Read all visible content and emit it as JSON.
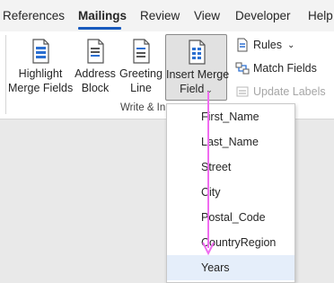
{
  "tabs": [
    {
      "label": "References",
      "active": false
    },
    {
      "label": "Mailings",
      "active": true
    },
    {
      "label": "Review",
      "active": false
    },
    {
      "label": "View",
      "active": false
    },
    {
      "label": "Developer",
      "active": false
    },
    {
      "label": "Help",
      "active": false
    }
  ],
  "ribbon": {
    "buttons": [
      {
        "line1": "Highlight",
        "line2": "Merge Fields",
        "icon": "highlight-merge-fields-icon"
      },
      {
        "line1": "Address",
        "line2": "Block",
        "icon": "address-block-icon"
      },
      {
        "line1": "Greeting",
        "line2": "Line",
        "icon": "greeting-line-icon"
      },
      {
        "line1": "Insert Merge",
        "line2": "Field",
        "icon": "insert-merge-field-icon"
      }
    ],
    "small": [
      {
        "label": "Rules",
        "icon": "rules-icon",
        "enabled": true
      },
      {
        "label": "Match Fields",
        "icon": "match-fields-icon",
        "enabled": true
      },
      {
        "label": "Update Labels",
        "icon": "update-labels-icon",
        "enabled": false
      }
    ],
    "group_label": "Write & In"
  },
  "dropdown": {
    "items": [
      "First_Name",
      "Last_Name",
      "Street",
      "City",
      "Postal_Code",
      "CountryRegion",
      "Years"
    ],
    "highlighted": "Years"
  },
  "colors": {
    "accent": "#185abd",
    "highlight": "#e5eefa",
    "arrow": "#f06cf0"
  }
}
